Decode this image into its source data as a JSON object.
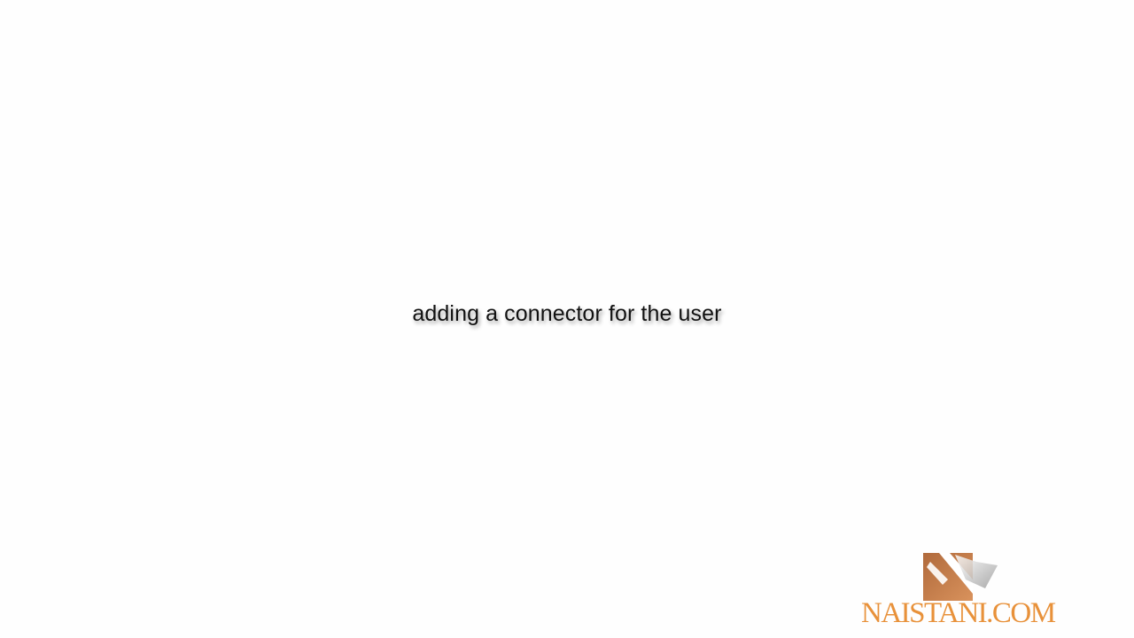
{
  "caption": {
    "text": "adding a connector for the user"
  },
  "logo": {
    "text": "NAISTANI.COM",
    "icon": "naistani-logo-mark",
    "brand_color": "#e8913a",
    "mark_color": "#c97a45"
  }
}
